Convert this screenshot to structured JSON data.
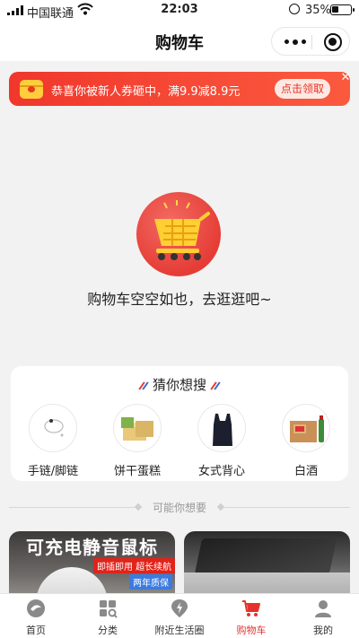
{
  "status_bar": {
    "carrier": "中国联通",
    "time": "22:03",
    "battery": "35%"
  },
  "nav": {
    "title": "购物车"
  },
  "coupon": {
    "text": "恭喜你被新人券砸中，满9.9减8.9元",
    "button": "点击领取",
    "close": "✕"
  },
  "empty_cart": {
    "message": "购物车空空如也，去逛逛吧~"
  },
  "guess": {
    "title": "猜你想搜",
    "items": [
      {
        "label": "手链/脚链",
        "icon": "bracelet-icon"
      },
      {
        "label": "饼干蛋糕",
        "icon": "biscuit-icon"
      },
      {
        "label": "女式背心",
        "icon": "vest-icon"
      },
      {
        "label": "白酒",
        "icon": "liquor-icon"
      }
    ]
  },
  "maybe": {
    "label": "可能你想要"
  },
  "products": [
    {
      "headline": "可充电静音鼠标",
      "tag1": "即插即用 超长续航",
      "tag2": "两年质保"
    },
    {
      "headline": ""
    }
  ],
  "tabbar": [
    {
      "label": "首页",
      "icon": "home-icon",
      "active": false
    },
    {
      "label": "分类",
      "icon": "category-icon",
      "active": false
    },
    {
      "label": "附近生活圈",
      "icon": "location-icon",
      "active": false
    },
    {
      "label": "购物车",
      "icon": "cart-icon",
      "active": true
    },
    {
      "label": "我的",
      "icon": "user-icon",
      "active": false
    }
  ],
  "colors": {
    "accent": "#e5322d",
    "coupon_start": "#f0372c",
    "coupon_end": "#fb5a3f",
    "background": "#f2f2f2"
  }
}
